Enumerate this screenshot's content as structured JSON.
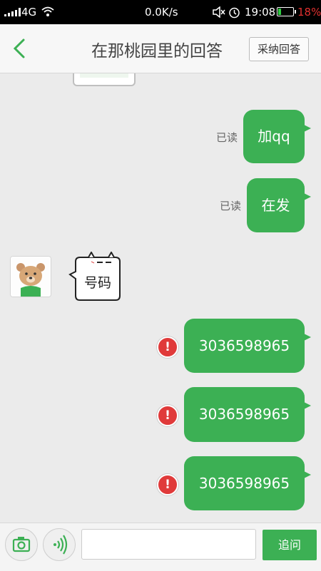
{
  "status_bar": {
    "network": "4G",
    "speed": "0.0K/s",
    "time": "19:08",
    "battery": "18%",
    "battery_level": 0.18
  },
  "header": {
    "title": "在那桃园里的回答",
    "accept_label": "采纳回答"
  },
  "messages": [
    {
      "side": "right",
      "text": "加qq",
      "read": "已读"
    },
    {
      "side": "right",
      "text": "在发",
      "read": "已读"
    },
    {
      "side": "left",
      "text": "号码"
    },
    {
      "side": "right",
      "text": "3036598965",
      "failed": true
    },
    {
      "side": "right",
      "text": "3036598965",
      "failed": true
    },
    {
      "side": "right",
      "text": "3036598965",
      "failed": true
    }
  ],
  "input": {
    "placeholder": "",
    "send_label": "追问"
  },
  "colors": {
    "accent": "#3cb054",
    "error": "#e03a3a",
    "battery_text": "#e0302f"
  }
}
